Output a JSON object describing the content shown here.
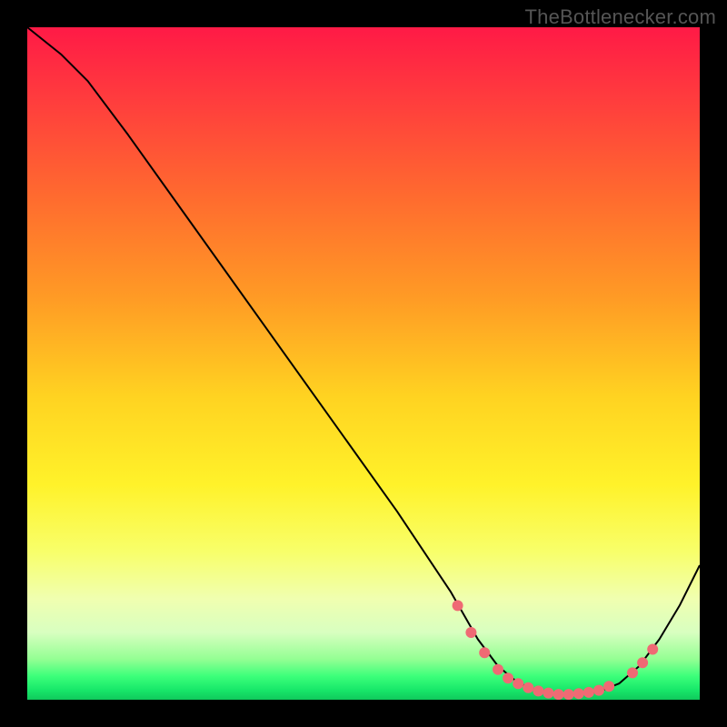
{
  "watermark": "TheBottlenecker.com",
  "chart_data": {
    "type": "line",
    "title": "",
    "xlabel": "",
    "ylabel": "",
    "xlim": [
      0,
      100
    ],
    "ylim": [
      0,
      100
    ],
    "background_gradient": {
      "stops": [
        {
          "offset": 0.0,
          "color": "#ff1a46"
        },
        {
          "offset": 0.1,
          "color": "#ff3a3e"
        },
        {
          "offset": 0.25,
          "color": "#ff6a2f"
        },
        {
          "offset": 0.4,
          "color": "#ff9a25"
        },
        {
          "offset": 0.55,
          "color": "#ffd321"
        },
        {
          "offset": 0.68,
          "color": "#fff22a"
        },
        {
          "offset": 0.78,
          "color": "#f8ff6a"
        },
        {
          "offset": 0.85,
          "color": "#f0ffb0"
        },
        {
          "offset": 0.9,
          "color": "#d8ffc0"
        },
        {
          "offset": 0.94,
          "color": "#93ff93"
        },
        {
          "offset": 0.965,
          "color": "#3cff7a"
        },
        {
          "offset": 0.985,
          "color": "#18e86a"
        },
        {
          "offset": 1.0,
          "color": "#10c95c"
        }
      ]
    },
    "series": [
      {
        "name": "bottleneck-curve",
        "color": "#000000",
        "stroke_width": 2,
        "x": [
          0,
          5,
          9,
          15,
          25,
          35,
          45,
          55,
          63,
          67,
          70,
          73,
          76,
          79,
          82,
          85,
          88,
          91,
          94,
          97,
          100
        ],
        "y": [
          100,
          96,
          92,
          84,
          70,
          56,
          42,
          28,
          16,
          9,
          5,
          2.5,
          1.3,
          0.8,
          0.8,
          1.2,
          2.4,
          5,
          9,
          14,
          20
        ]
      }
    ],
    "markers": {
      "name": "highlight-dots",
      "color": "#ef6a74",
      "radius": 6,
      "points": [
        {
          "x": 64,
          "y": 14
        },
        {
          "x": 66,
          "y": 10
        },
        {
          "x": 68,
          "y": 7
        },
        {
          "x": 70,
          "y": 4.5
        },
        {
          "x": 71.5,
          "y": 3.2
        },
        {
          "x": 73,
          "y": 2.4
        },
        {
          "x": 74.5,
          "y": 1.8
        },
        {
          "x": 76,
          "y": 1.3
        },
        {
          "x": 77.5,
          "y": 1.0
        },
        {
          "x": 79,
          "y": 0.8
        },
        {
          "x": 80.5,
          "y": 0.8
        },
        {
          "x": 82,
          "y": 0.9
        },
        {
          "x": 83.5,
          "y": 1.1
        },
        {
          "x": 85,
          "y": 1.4
        },
        {
          "x": 86.5,
          "y": 2.0
        },
        {
          "x": 90,
          "y": 4.0
        },
        {
          "x": 91.5,
          "y": 5.5
        },
        {
          "x": 93,
          "y": 7.5
        }
      ]
    }
  }
}
